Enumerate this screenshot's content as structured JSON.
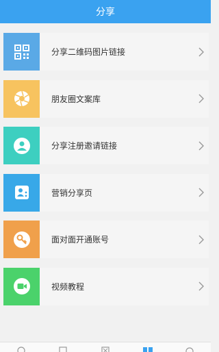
{
  "header": {
    "title": "分享"
  },
  "items": [
    {
      "label": "分享二维码图片链接",
      "icon": "qr-code-icon",
      "color": "#5aa9e6"
    },
    {
      "label": "朋友圈文案库",
      "icon": "camera-aperture-icon",
      "color": "#f7c35f"
    },
    {
      "label": "分享注册邀请链接",
      "icon": "user-invite-icon",
      "color": "#3dcfc0"
    },
    {
      "label": "营销分享页",
      "icon": "share-profile-icon",
      "color": "#38a8e8"
    },
    {
      "label": "面对面开通账号",
      "icon": "key-icon",
      "color": "#f0a04b"
    },
    {
      "label": "视频教程",
      "icon": "video-camera-icon",
      "color": "#4bd26b"
    }
  ],
  "tabbar": {
    "icons": [
      "tab-icon-1",
      "tab-icon-2",
      "tab-icon-3",
      "tab-icon-share",
      "tab-icon-5"
    ],
    "active_color": "#3aa2f0"
  }
}
